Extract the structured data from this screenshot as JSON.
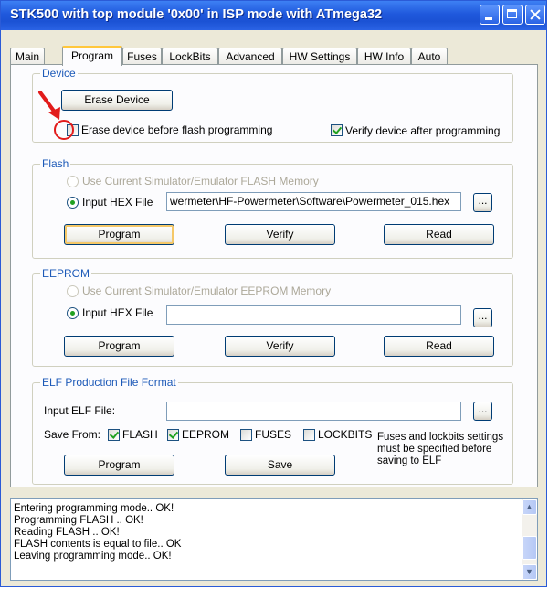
{
  "window": {
    "title": "STK500 with top module '0x00' in ISP mode with ATmega32"
  },
  "tabs": [
    "Main",
    "Program",
    "Fuses",
    "LockBits",
    "Advanced",
    "HW Settings",
    "HW Info",
    "Auto"
  ],
  "device": {
    "group_title": "Device",
    "erase_button": "Erase Device",
    "erase_before_flash": "Erase device before flash programming",
    "verify_after": "Verify device after programming"
  },
  "flash": {
    "group_title": "Flash",
    "use_simulator": "Use Current Simulator/Emulator FLASH Memory",
    "input_hex": "Input HEX File",
    "file_path": "wermeter\\HF-Powermeter\\Software\\Powermeter_015.hex",
    "browse": "...",
    "program": "Program",
    "verify": "Verify",
    "read": "Read"
  },
  "eeprom": {
    "group_title": "EEPROM",
    "use_simulator": "Use Current Simulator/Emulator EEPROM Memory",
    "input_hex": "Input HEX File",
    "file_path": "",
    "browse": "...",
    "program": "Program",
    "verify": "Verify",
    "read": "Read"
  },
  "elf": {
    "group_title": "ELF Production File Format",
    "input_label": "Input ELF File:",
    "file_path": "",
    "browse": "...",
    "save_from": "Save From:",
    "flash": "FLASH",
    "eeprom": "EEPROM",
    "fuses": "FUSES",
    "lockbits": "LOCKBITS",
    "note_1": "Fuses and lockbits settings",
    "note_2": "must be specified before",
    "note_3": "saving to ELF",
    "program": "Program",
    "save": "Save"
  },
  "log": [
    "Entering programming mode.. OK!",
    "Programming FLASH ..     OK!",
    "Reading FLASH ..     OK!",
    "FLASH contents is equal to file.. OK",
    "Leaving programming mode.. OK!"
  ],
  "colors": {
    "title_bar": "#1f58dc",
    "group_title": "#1d5ab8",
    "annotation": "#e21b1b"
  }
}
